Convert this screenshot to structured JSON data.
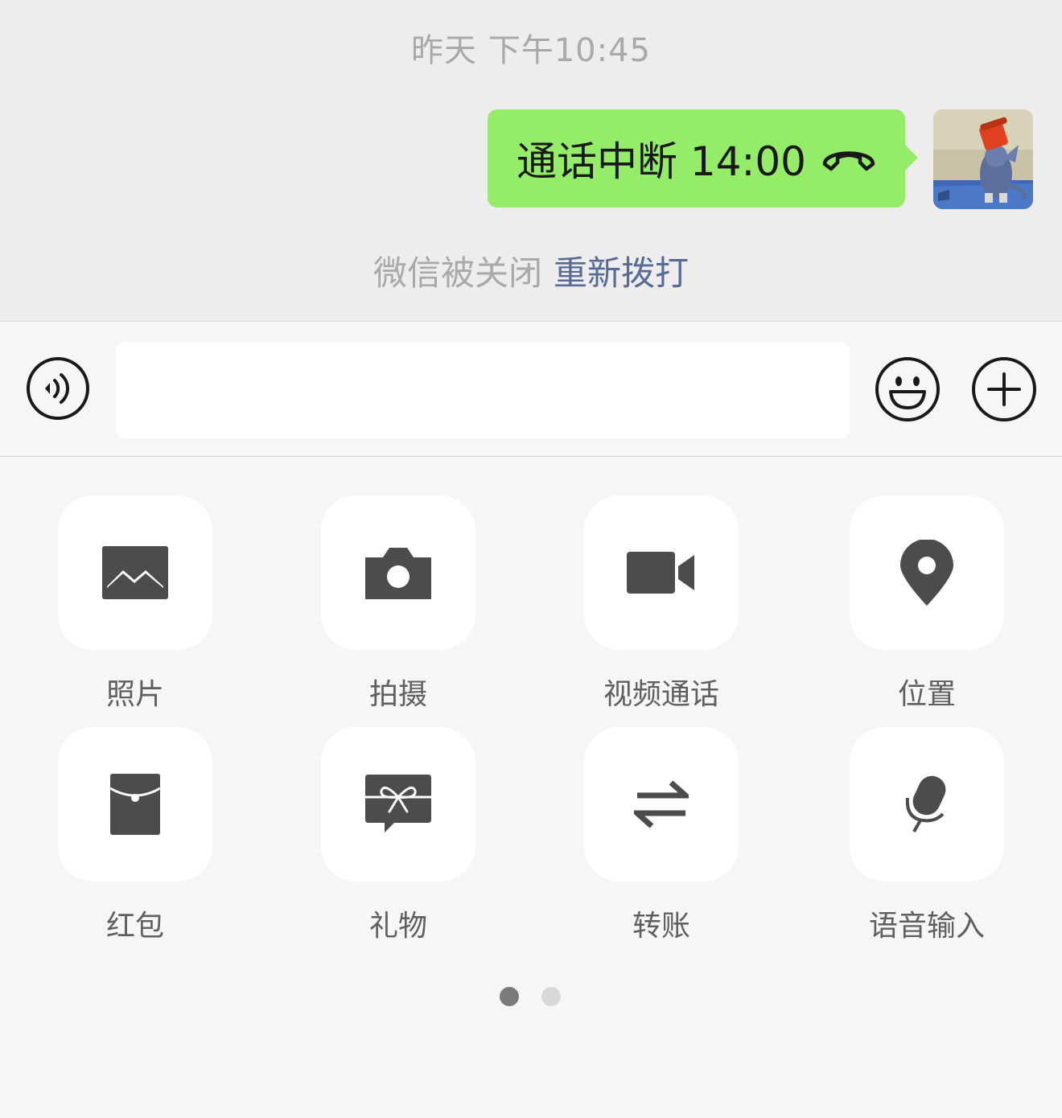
{
  "chat": {
    "timestamp": "昨天 下午10:45",
    "message": {
      "text": "通话中断 14:00",
      "bubble_color": "#95ec69",
      "icon": "hangup-phone-icon"
    },
    "avatar": "avatar-image",
    "notice": {
      "text": "微信被关闭",
      "link": "重新拨打",
      "link_color": "#576b95"
    }
  },
  "input_bar": {
    "voice_icon": "voice-icon",
    "text_value": "",
    "emoji_icon": "emoji-icon",
    "plus_icon": "plus-icon"
  },
  "panel": {
    "items": [
      {
        "label": "照片",
        "icon": "photo-icon"
      },
      {
        "label": "拍摄",
        "icon": "camera-icon"
      },
      {
        "label": "视频通话",
        "icon": "video-call-icon"
      },
      {
        "label": "位置",
        "icon": "location-icon"
      },
      {
        "label": "红包",
        "icon": "red-packet-icon"
      },
      {
        "label": "礼物",
        "icon": "gift-icon"
      },
      {
        "label": "转账",
        "icon": "transfer-icon"
      },
      {
        "label": "语音输入",
        "icon": "microphone-icon"
      }
    ],
    "page_indicator": {
      "pages": 2,
      "current": 1
    }
  }
}
